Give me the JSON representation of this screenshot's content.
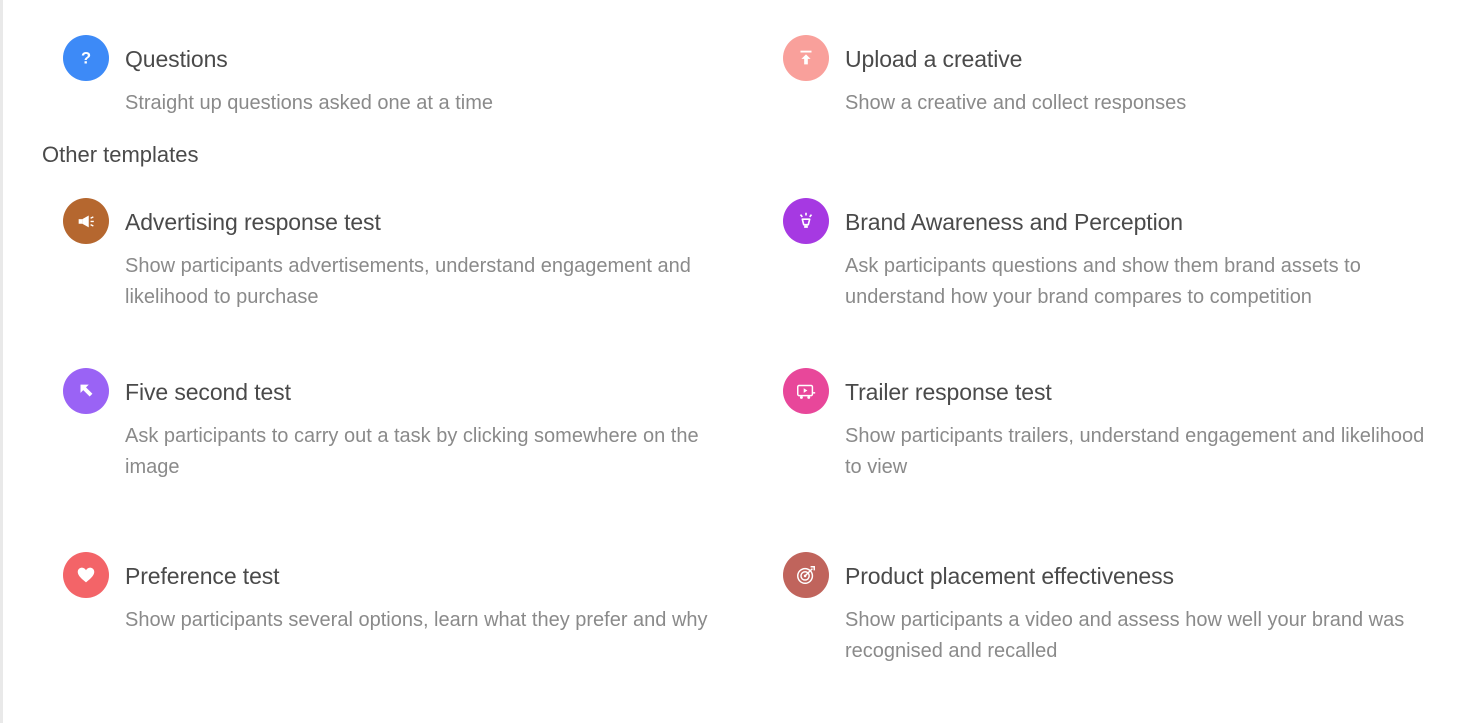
{
  "top_templates": [
    {
      "title": "Questions",
      "description": "Straight up questions asked one at a time",
      "icon": "question-icon",
      "color": "#3d8af7"
    },
    {
      "title": "Upload a creative",
      "description": "Show a creative and collect responses",
      "icon": "upload-icon",
      "color": "#f9a09b"
    }
  ],
  "other_templates_heading": "Other templates",
  "other_templates": [
    {
      "title": "Advertising response test",
      "description": "Show participants advertisements, understand engagement and likelihood to purchase",
      "icon": "megaphone-icon",
      "color": "#b5672f"
    },
    {
      "title": "Brand Awareness and Perception",
      "description": "Ask participants questions and show them brand assets to understand how your brand compares to competition",
      "icon": "lightbulb-icon",
      "color": "#a639e2"
    },
    {
      "title": "Five second test",
      "description": "Ask participants to carry out a task by clicking somewhere on the image",
      "icon": "cursor-arrow-icon",
      "color": "#9a63f5"
    },
    {
      "title": "Trailer response test",
      "description": "Show participants trailers, understand engagement and likelihood to view",
      "icon": "film-trailer-icon",
      "color": "#e8479a"
    },
    {
      "title": "Preference test",
      "description": "Show participants several options, learn what they prefer and why",
      "icon": "heart-icon",
      "color": "#f36468"
    },
    {
      "title": "Product placement effectiveness",
      "description": "Show participants a video and assess how well your brand was recognised and recalled",
      "icon": "target-icon",
      "color": "#c0645c"
    }
  ]
}
